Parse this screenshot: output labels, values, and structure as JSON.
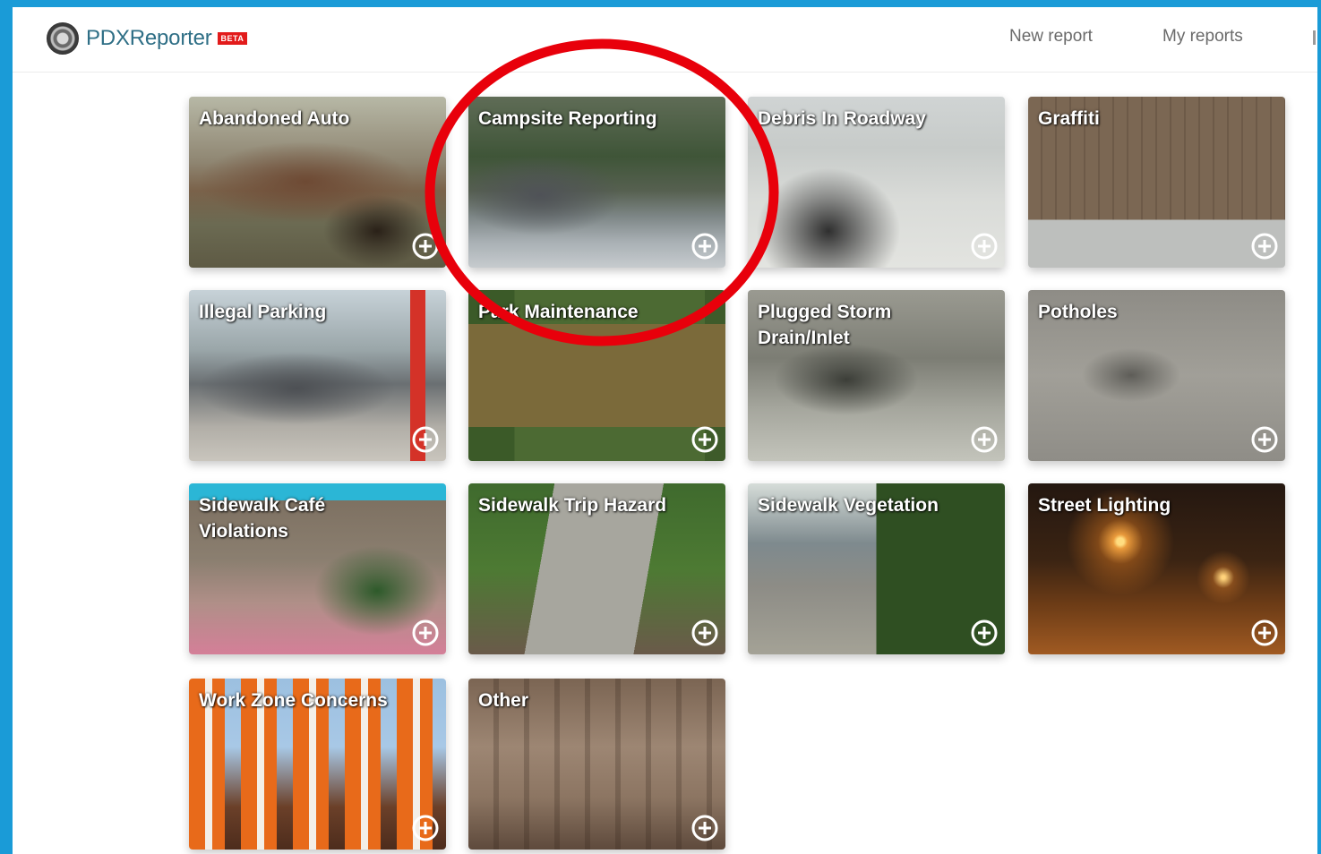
{
  "header": {
    "brand": "PDXReporter",
    "beta_badge": "BETA",
    "nav": [
      {
        "label": "New report"
      },
      {
        "label": "My reports"
      }
    ]
  },
  "tiles": [
    {
      "label": "Abandoned Auto"
    },
    {
      "label": "Campsite Reporting"
    },
    {
      "label": "Debris In Roadway"
    },
    {
      "label": "Graffiti"
    },
    {
      "label": "Illegal Parking"
    },
    {
      "label": "Park Maintenance"
    },
    {
      "label": "Plugged Storm Drain/Inlet"
    },
    {
      "label": "Potholes"
    },
    {
      "label": "Sidewalk Café Violations"
    },
    {
      "label": "Sidewalk Trip Hazard"
    },
    {
      "label": "Sidewalk Vegetation"
    },
    {
      "label": "Street Lighting"
    },
    {
      "label": "Work Zone Concerns"
    },
    {
      "label": "Other"
    }
  ],
  "colors": {
    "frame": "#1a9bd7",
    "brand_text": "#2f6f86",
    "beta_badge": "#e21b1b",
    "annotation_circle": "#e8000b"
  },
  "icons": {
    "logo": "city-seal-icon",
    "tile_action": "plus-circle-icon"
  }
}
